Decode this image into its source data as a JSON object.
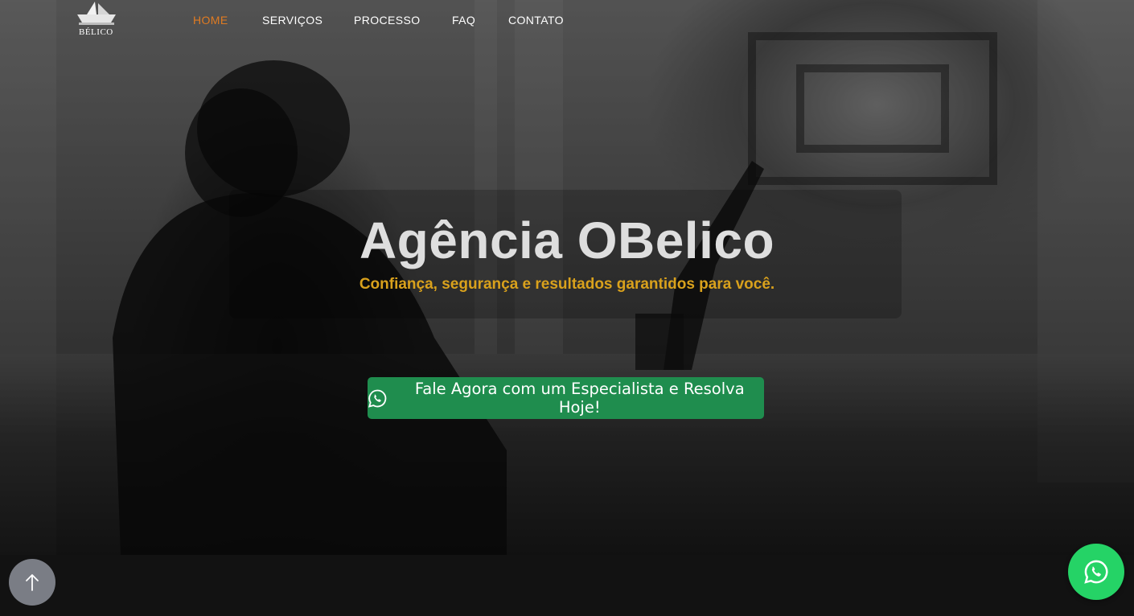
{
  "brand": {
    "logo_text": "BÉLICO"
  },
  "nav": {
    "items": [
      {
        "label": "HOME",
        "active": true
      },
      {
        "label": "SERVIÇOS",
        "active": false
      },
      {
        "label": "PROCESSO",
        "active": false
      },
      {
        "label": "FAQ",
        "active": false
      },
      {
        "label": "CONTATO",
        "active": false
      }
    ]
  },
  "hero": {
    "title": "Agência OBelico",
    "subtitle": "Confiança, segurança e resultados garantidos para você.",
    "cta_label": "Fale Agora com um Especialista e Resolva Hoje!",
    "cta_icon": "whatsapp-icon"
  },
  "floating": {
    "scroll_top_icon": "arrow-up-icon",
    "whatsapp_icon": "whatsapp-icon"
  },
  "colors": {
    "nav_active": "#e07b22",
    "subtitle": "#d9a11c",
    "cta_bg": "#1f8d4e",
    "whatsapp_float": "#25d366",
    "scroll_top_bg": "#7a7d85",
    "footer_bg": "#121212"
  }
}
